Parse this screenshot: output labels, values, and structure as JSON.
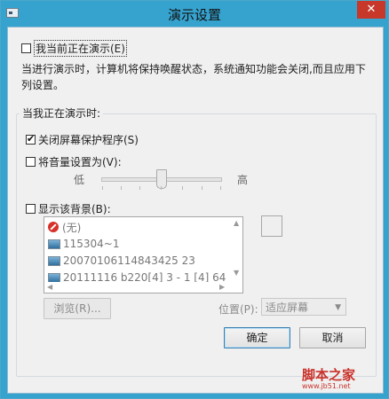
{
  "window": {
    "title": "演示设置",
    "close_label": "✕"
  },
  "presenting": {
    "label": "我当前正在演示(E)",
    "checked": false
  },
  "description": "当进行演示时，计算机将保持唤醒状态，系统通知功能会关闭,而且应用下列设置。",
  "group": {
    "label": "当我正在演示时:"
  },
  "screensaver": {
    "label": "关闭屏幕保护程序(S)",
    "checked": true
  },
  "volume": {
    "label": "将音量设置为(V):",
    "checked": false,
    "low": "低",
    "high": "高",
    "level_fraction": 0.5
  },
  "background": {
    "label": "显示该背景(B):",
    "checked": false,
    "items": [
      "(无)",
      "115304~1",
      "20070106114843425 23",
      "20111116 b220[4] 3 - 1 [4] 64"
    ]
  },
  "browse_label": "浏览(R)...",
  "position": {
    "label": "位置(P):",
    "value": "适应屏幕"
  },
  "ok_label": "确定",
  "cancel_label": "取消",
  "watermark": {
    "line1": "脚本之家",
    "line2": "www.jb51.net"
  }
}
